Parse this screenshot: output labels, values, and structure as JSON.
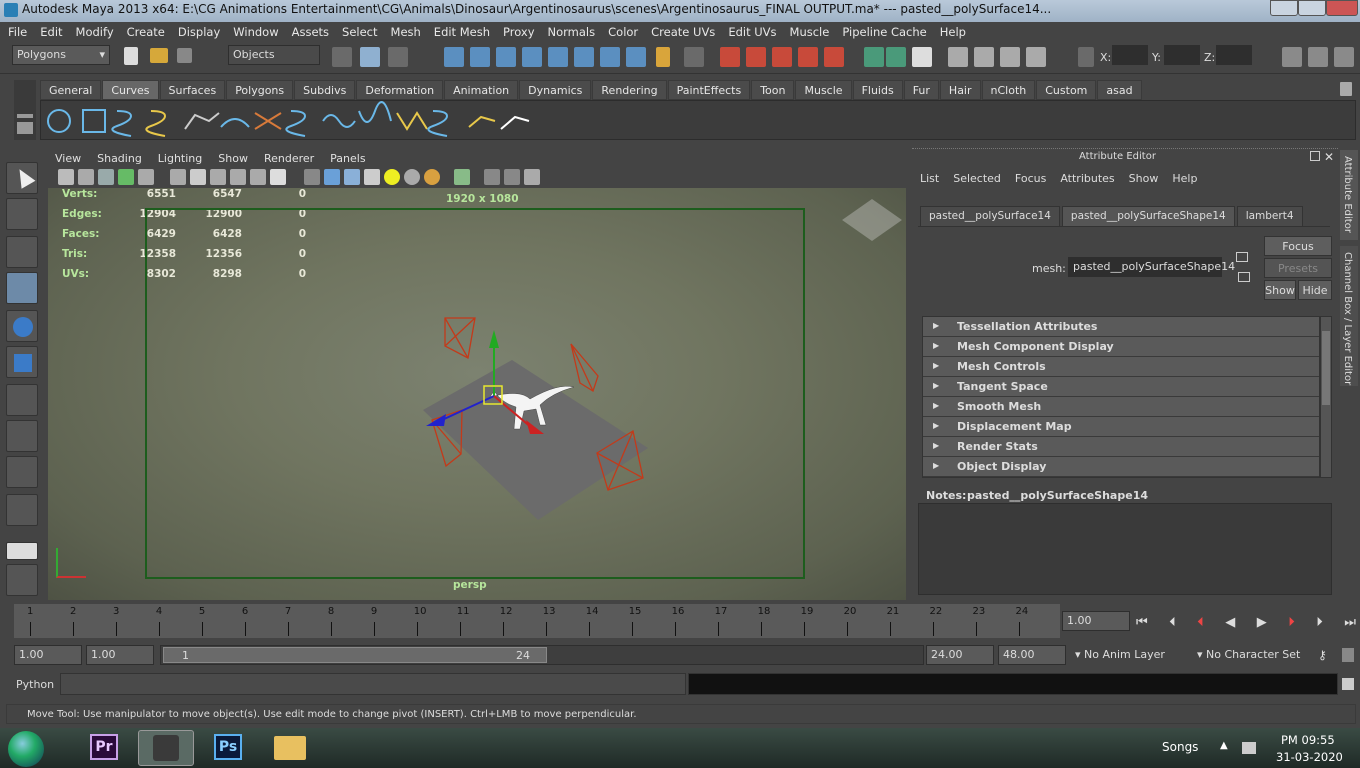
{
  "title": "Autodesk Maya 2013 x64: E:\\CG Animations Entertainment\\CG\\Animals\\Dinosaur\\Argentinosaurus\\scenes\\Argentinosaurus_FINAL OUTPUT.ma*   ---   pasted__polySurface14...",
  "menu": [
    "File",
    "Edit",
    "Modify",
    "Create",
    "Display",
    "Window",
    "Assets",
    "Select",
    "Mesh",
    "Edit Mesh",
    "Proxy",
    "Normals",
    "Color",
    "Create UVs",
    "Edit UVs",
    "Muscle",
    "Pipeline Cache",
    "Help"
  ],
  "status_line": {
    "menu_set": "Polygons",
    "selection_mode": "Objects",
    "x_label": "X:",
    "y_label": "Y:",
    "z_label": "Z:"
  },
  "shelf_tabs": [
    "General",
    "Curves",
    "Surfaces",
    "Polygons",
    "Subdivs",
    "Deformation",
    "Animation",
    "Dynamics",
    "Rendering",
    "PaintEffects",
    "Toon",
    "Muscle",
    "Fluids",
    "Fur",
    "Hair",
    "nCloth",
    "Custom",
    "asad"
  ],
  "shelf_active": "Curves",
  "panel_menu": [
    "View",
    "Shading",
    "Lighting",
    "Show",
    "Renderer",
    "Panels"
  ],
  "hud": {
    "rows": [
      {
        "label": "Verts:",
        "a": "6551",
        "b": "6547",
        "c": "0"
      },
      {
        "label": "Edges:",
        "a": "12904",
        "b": "12900",
        "c": "0"
      },
      {
        "label": "Faces:",
        "a": "6429",
        "b": "6428",
        "c": "0"
      },
      {
        "label": "Tris:",
        "a": "12358",
        "b": "12356",
        "c": "0"
      },
      {
        "label": "UVs:",
        "a": "8302",
        "b": "8298",
        "c": "0"
      }
    ],
    "resolution": "1920 x 1080",
    "camera": "persp"
  },
  "attribute_editor": {
    "title": "Attribute Editor",
    "menu": [
      "List",
      "Selected",
      "Focus",
      "Attributes",
      "Show",
      "Help"
    ],
    "tabs": [
      "pasted__polySurface14",
      "pasted__polySurfaceShape14",
      "lambert4"
    ],
    "active_tab": "pasted__polySurfaceShape14",
    "mesh_label": "mesh:",
    "mesh_value": "pasted__polySurfaceShape14",
    "focus": "Focus",
    "presets": "Presets",
    "show": "Show",
    "hide": "Hide",
    "sections": [
      "Tessellation Attributes",
      "Mesh Component Display",
      "Mesh Controls",
      "Tangent Space",
      "Smooth Mesh",
      "Displacement Map",
      "Render Stats",
      "Object Display"
    ],
    "notes_label": "Notes:",
    "notes_value": "pasted__polySurfaceShape14",
    "side_tabs": [
      "Attribute Editor",
      "Channel Box / Layer Editor"
    ]
  },
  "timeline": {
    "ticks": [
      "1",
      "2",
      "3",
      "4",
      "5",
      "6",
      "7",
      "8",
      "9",
      "10",
      "11",
      "12",
      "13",
      "14",
      "15",
      "16",
      "17",
      "18",
      "19",
      "20",
      "21",
      "22",
      "23",
      "24"
    ],
    "current_time": "1.00"
  },
  "range": {
    "start": "1.00",
    "playback_start": "1.00",
    "slider_left": "1",
    "slider_right": "24",
    "playback_end": "24.00",
    "end": "48.00",
    "anim_layer": "No Anim Layer",
    "character_set": "No Character Set"
  },
  "command_line": {
    "language": "Python"
  },
  "help_line": "Move Tool: Use manipulator to move object(s). Use edit mode to change pivot (INSERT).  Ctrl+LMB to move perpendicular.",
  "taskbar": {
    "apps": [
      "Pr",
      "Ps"
    ],
    "language": "Songs",
    "time": "PM 09:55",
    "date": "31-03-2020"
  },
  "colors": {
    "maya_bg": "#444444",
    "hud_label": "#b7e69c",
    "gate": "#1d5d1d",
    "manip_y": "#22aa22",
    "manip_x": "#cc2222",
    "manip_z": "#2222cc",
    "camera": "#c33a1a"
  }
}
